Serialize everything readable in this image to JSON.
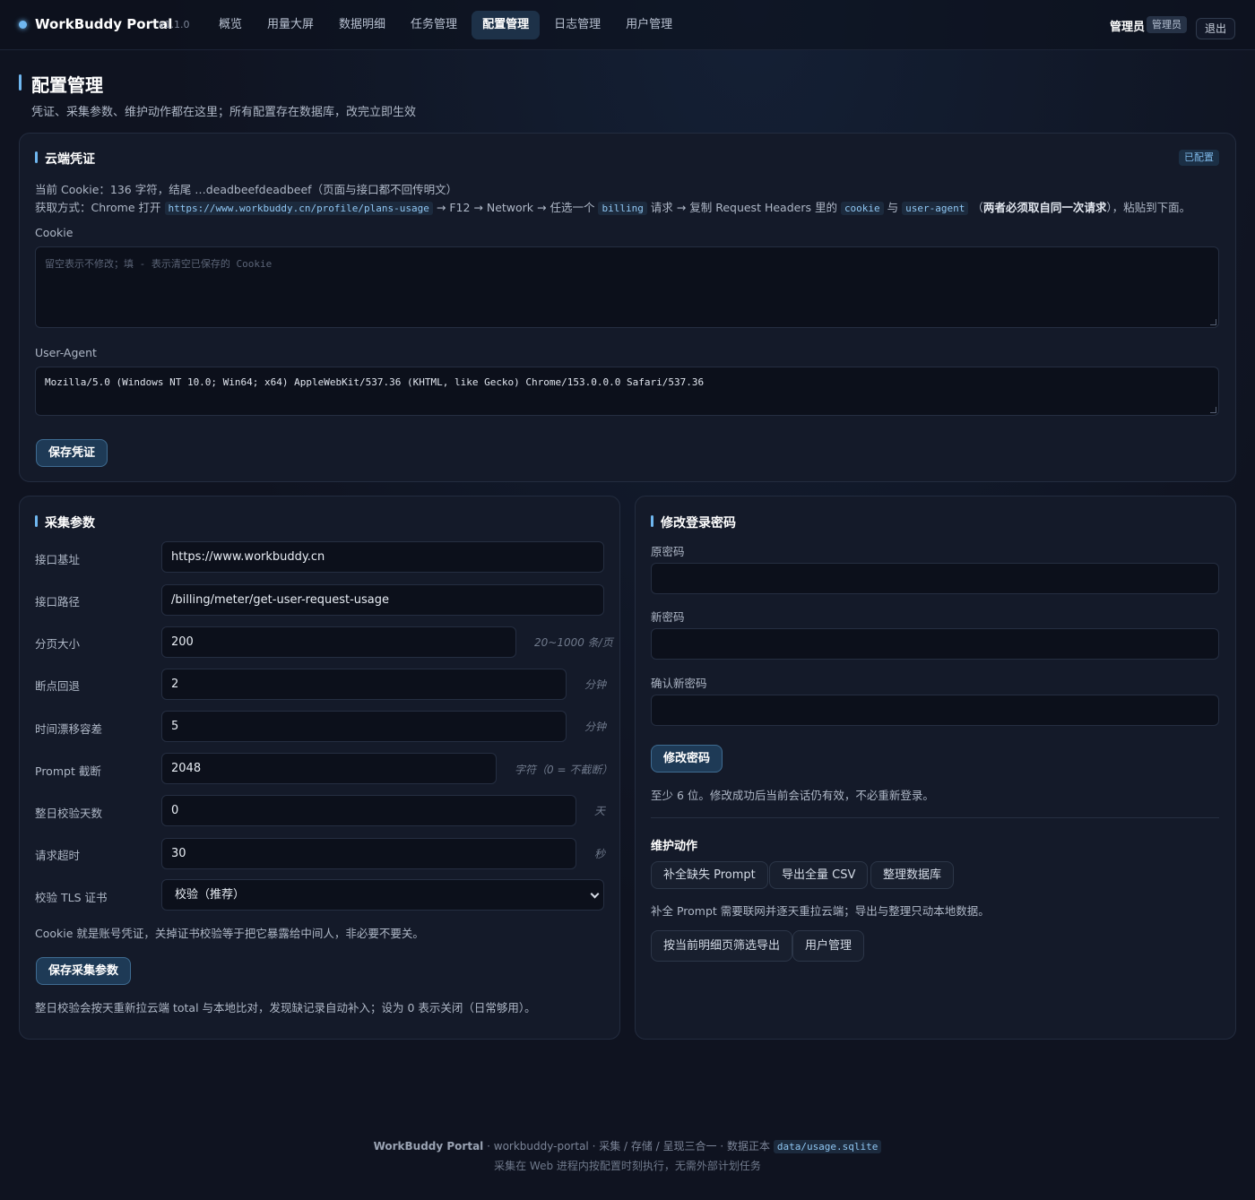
{
  "app": {
    "brand": "WorkBuddy Portal",
    "version": "v1.1.0",
    "accent_color": "#6fb7f0"
  },
  "nav": {
    "items": [
      {
        "label": "概览"
      },
      {
        "label": "用量大屏"
      },
      {
        "label": "数据明细"
      },
      {
        "label": "任务管理"
      },
      {
        "label": "配置管理",
        "active": true
      },
      {
        "label": "日志管理"
      },
      {
        "label": "用户管理"
      }
    ],
    "user_name": "管理员",
    "user_role": "管理员",
    "logout_label": "退出"
  },
  "page": {
    "title": "配置管理",
    "subtitle": "凭证、采集参数、维护动作都在这里；所有配置存在数据库，改完立即生效"
  },
  "credentials": {
    "title": "云端凭证",
    "status": "已配置",
    "current_info": "当前 Cookie：136 字符，结尾 …deadbeefdeadbeef（页面与接口都不回传明文）",
    "howto_prefix": "获取方式：Chrome 打开",
    "howto_url": "https://www.workbuddy.cn/profile/plans-usage",
    "howto_mid1": "→ F12 → Network → 任选一个",
    "howto_billing": "billing",
    "howto_mid2": "请求 → 复制 Request Headers 里的",
    "howto_cookie": "cookie",
    "howto_and": "与",
    "howto_ua": "user-agent",
    "howto_open": "（",
    "howto_strong": "两者必须取自同一次请求",
    "howto_suffix": "），粘贴到下面。",
    "cookie_label": "Cookie",
    "cookie_placeholder": "留空表示不修改；填 - 表示清空已保存的 Cookie",
    "ua_label": "User-Agent",
    "ua_value": "Mozilla/5.0 (Windows NT 10.0; Win64; x64) AppleWebKit/537.36 (KHTML, like Gecko) Chrome/153.0.0.0 Safari/537.36",
    "save_label": "保存凭证"
  },
  "collect": {
    "title": "采集参数",
    "fields": [
      {
        "label": "接口基址",
        "value": "https://www.workbuddy.cn",
        "unit": ""
      },
      {
        "label": "接口路径",
        "value": "/billing/meter/get-user-request-usage",
        "unit": ""
      },
      {
        "label": "分页大小",
        "value": "200",
        "unit": "20~1000 条/页"
      },
      {
        "label": "断点回退",
        "value": "2",
        "unit": "分钟"
      },
      {
        "label": "时间漂移容差",
        "value": "5",
        "unit": "分钟"
      },
      {
        "label": "Prompt 截断",
        "value": "2048",
        "unit": "字符（0 = 不截断）"
      },
      {
        "label": "整日校验天数",
        "value": "0",
        "unit": "天"
      },
      {
        "label": "请求超时",
        "value": "30",
        "unit": "秒"
      }
    ],
    "tls_label": "校验 TLS 证书",
    "tls_value": "校验（推荐）",
    "tls_note": "Cookie 就是账号凭证，关掉证书校验等于把它暴露给中间人，非必要不要关。",
    "save_label": "保存采集参数",
    "footnote": "整日校验会按天重新拉云端 total 与本地比对，发现缺记录自动补入；设为 0 表示关闭（日常够用）。"
  },
  "password": {
    "title": "修改登录密码",
    "old_label": "原密码",
    "new_label": "新密码",
    "confirm_label": "确认新密码",
    "submit_label": "修改密码",
    "hint": "至少 6 位。修改成功后当前会话仍有效，不必重新登录。"
  },
  "maintenance": {
    "title": "维护动作",
    "btn_fill_prompt": "补全缺失 Prompt",
    "btn_export_csv": "导出全量 CSV",
    "btn_tidy_db": "整理数据库",
    "note": "补全 Prompt 需要联网并逐天重拉云端；导出与整理只动本地数据。",
    "btn_export_filtered": "按当前明细页筛选导出",
    "btn_user_mgmt": "用户管理"
  },
  "footer": {
    "brand": "WorkBuddy Portal",
    "line1": "· workbuddy-portal · 采集 / 存储 / 呈现三合一 · 数据正本",
    "db_path": "data/usage.sqlite",
    "line2": "采集在 Web 进程内按配置时刻执行，无需外部计划任务"
  }
}
